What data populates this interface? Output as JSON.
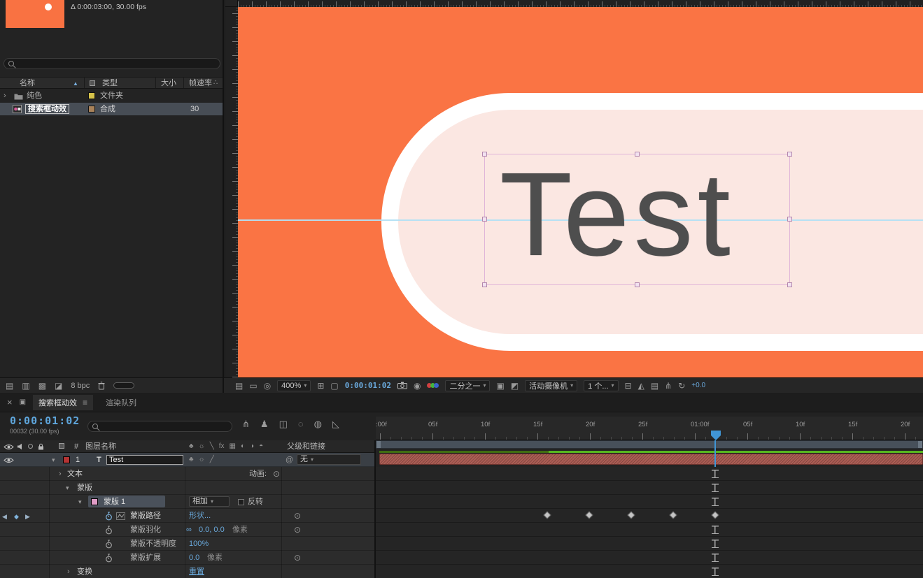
{
  "project": {
    "preview_info": "Δ 0:00:03:00, 30.00 fps",
    "columns": {
      "name": "名称",
      "type": "类型",
      "size": "大小",
      "framerate": "帧速率"
    },
    "rows": [
      {
        "name": "纯色",
        "type": "文件夹",
        "size": "",
        "framerate": ""
      },
      {
        "name": "搜索框动效",
        "type": "合成",
        "size": "",
        "framerate": "30"
      }
    ],
    "footer": {
      "bpc": "8 bpc"
    }
  },
  "viewer": {
    "canvas_text": "Test",
    "toolbar": {
      "zoom": "400%",
      "timecode": "0:00:01:02",
      "resolution": "二分之一",
      "camera": "活动摄像机",
      "view_layout": "1 个...",
      "exposure": "+0.0"
    }
  },
  "timeline": {
    "tabs": [
      {
        "label": "搜索框动效",
        "active": true
      },
      {
        "label": "渲染队列",
        "active": false
      }
    ],
    "timecode": "0:00:01:02",
    "frame_info": "00032 (30.00 fps)",
    "columns": {
      "hash": "#",
      "layer_name": "图层名称",
      "parent_link": "父级和链接"
    },
    "layer": {
      "index": "1",
      "type_icon": "T",
      "name": "Test",
      "parent": "无"
    },
    "rows": {
      "text": {
        "label": "文本",
        "animate_label": "动画:"
      },
      "masks": {
        "label": "蒙版"
      },
      "mask1": {
        "label": "蒙版 1",
        "mode": "相加",
        "invert_label": "反转"
      },
      "mask_path": {
        "label": "蒙版路径",
        "value": "形状..."
      },
      "mask_feather": {
        "label": "蒙版羽化",
        "value": "0.0, 0.0",
        "unit": "像素"
      },
      "mask_opacity": {
        "label": "蒙版不透明度",
        "value": "100%"
      },
      "mask_expansion": {
        "label": "蒙版扩展",
        "value": "0.0",
        "unit": "像素"
      },
      "transform": {
        "label": "变换",
        "reset_label": "重置"
      }
    },
    "ruler": {
      "labels": [
        ":00f",
        "05f",
        "10f",
        "15f",
        "20f",
        "25f",
        "01:00f",
        "05f",
        "10f",
        "15f",
        "20f"
      ]
    },
    "keyframe_frames": [
      16,
      20,
      24,
      28,
      32
    ],
    "current_frame": 32
  },
  "icons": {
    "close": "×",
    "menu": "≡",
    "chevron_down": "▾",
    "sort_asc": "▲",
    "disclosure": "›",
    "expand_down": "▾",
    "flowchart": "∴",
    "animate_target": "⊙",
    "include_circle": "⊙",
    "link_chain": "∞",
    "nav_prev": "◀",
    "nav_diamond": "◆",
    "nav_next": "▶",
    "pickwhip": "@",
    "panel_tab": "▣",
    "refresh": "↻",
    "project_footer": [
      {
        "name": "interpret-footage-icon",
        "glyph": "▤"
      },
      {
        "name": "new-folder-icon",
        "glyph": "▥"
      },
      {
        "name": "new-composition-icon",
        "glyph": "▩"
      },
      {
        "name": "color-depth-icon",
        "glyph": "◪"
      }
    ],
    "timeline_tools": [
      {
        "name": "mini-flowchart-icon",
        "glyph": "⋔"
      },
      {
        "name": "shy-layers-icon",
        "glyph": "♟"
      },
      {
        "name": "frame-blending-icon",
        "glyph": "◫"
      },
      {
        "name": "motion-blur-icon",
        "glyph": "◌"
      },
      {
        "name": "brainstorm-icon",
        "glyph": "◍"
      },
      {
        "name": "graph-editor-icon",
        "glyph": "◺"
      }
    ],
    "switch_headers": [
      {
        "name": "shy-column-icon",
        "glyph": "♣"
      },
      {
        "name": "collapse-column-icon",
        "glyph": "☼"
      },
      {
        "name": "quality-column-icon",
        "glyph": "╲"
      },
      {
        "name": "fx-column-icon",
        "glyph": "fx"
      },
      {
        "name": "frame-blend-column-icon",
        "glyph": "▦"
      },
      {
        "name": "motion-blur-column-icon",
        "glyph": "◐"
      },
      {
        "name": "adjustment-column-icon",
        "glyph": "◑"
      },
      {
        "name": "threed-column-icon",
        "glyph": "◓"
      }
    ],
    "layer_switches": [
      {
        "name": "layer-shy-icon",
        "glyph": "♣"
      },
      {
        "name": "layer-collapse-icon",
        "glyph": "☼"
      },
      {
        "name": "layer-quality-icon",
        "glyph": "╱"
      }
    ],
    "viewer_seg1": [
      {
        "name": "flowchart-view-icon",
        "glyph": "▤"
      },
      {
        "name": "screen-icon",
        "glyph": "▭"
      },
      {
        "name": "view-options-icon",
        "glyph": "◎"
      }
    ],
    "viewer_seg2": [
      {
        "name": "grid-guides-icon",
        "glyph": "⊞"
      },
      {
        "name": "region-of-interest-icon",
        "glyph": "▢"
      }
    ],
    "viewer_seg4": [
      {
        "name": "target-region-icon",
        "glyph": "▣"
      },
      {
        "name": "transparency-grid-icon",
        "glyph": "◩"
      }
    ],
    "viewer_seg5": [
      {
        "name": "pixel-aspect-icon",
        "glyph": "⊟"
      },
      {
        "name": "fast-preview-icon",
        "glyph": "◭"
      },
      {
        "name": "timeline-button-icon",
        "glyph": "▤"
      },
      {
        "name": "comp-flowchart-icon",
        "glyph": "⋔"
      }
    ]
  }
}
